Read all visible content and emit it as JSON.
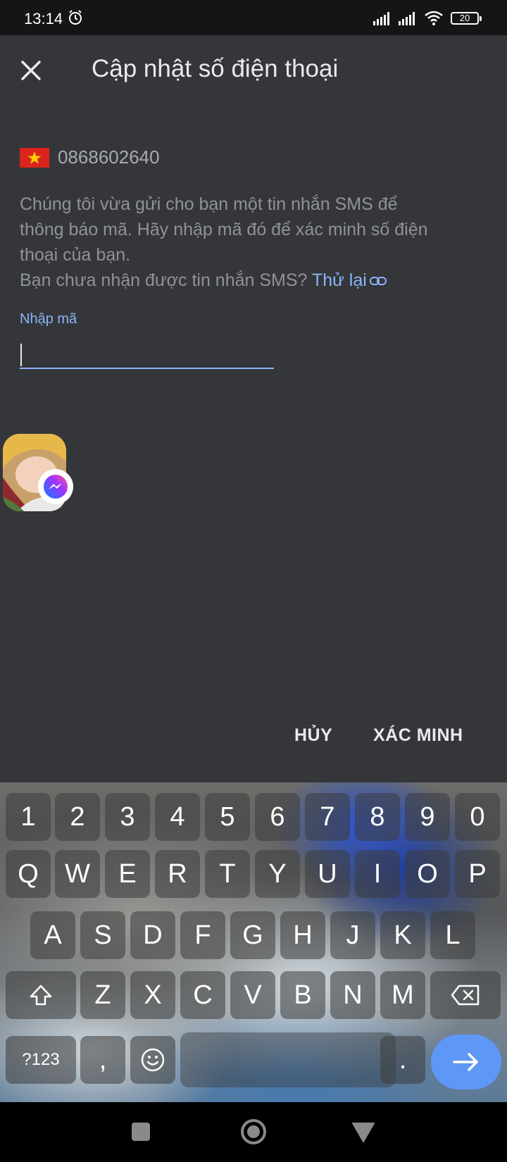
{
  "status_bar": {
    "time": "13:14",
    "battery": "20",
    "icons": [
      "alarm-icon",
      "signal-icon",
      "signal-icon",
      "wifi-icon",
      "battery-icon"
    ]
  },
  "header": {
    "title": "Cập nhật số điện thoại",
    "close_icon": "close-icon"
  },
  "phone": {
    "flag": "vietnam-flag-icon",
    "number": "0868602640"
  },
  "description": {
    "line1": "Chúng tôi vừa gửi cho bạn một tin nhắn SMS để",
    "line2": "thông báo mã. Hãy nhập mã đó để xác minh số điện",
    "line3": "thoại của bạn.",
    "line4_prefix": "Bạn chưa nhận được tin nhắn SMS? ",
    "retry_label": "Thử lại"
  },
  "code_field": {
    "label": "Nhập mã",
    "value": ""
  },
  "chat_head": {
    "badge": "messenger-icon"
  },
  "actions": {
    "cancel_label": "HỦY",
    "verify_label": "XÁC MINH"
  },
  "keyboard": {
    "row1": [
      "1",
      "2",
      "3",
      "4",
      "5",
      "6",
      "7",
      "8",
      "9",
      "0"
    ],
    "row2": [
      "Q",
      "W",
      "E",
      "R",
      "T",
      "Y",
      "U",
      "I",
      "O",
      "P"
    ],
    "row3": [
      "A",
      "S",
      "D",
      "F",
      "G",
      "H",
      "J",
      "K",
      "L"
    ],
    "row4": [
      "Z",
      "X",
      "C",
      "V",
      "B",
      "N",
      "M"
    ],
    "symbols_label": "?123",
    "comma": ",",
    "period": ".",
    "emoji": "emoji-icon",
    "backspace": "backspace-icon",
    "enter": "arrow-right-icon"
  },
  "nav_bar": {
    "items": [
      "recents-icon",
      "home-icon",
      "back-icon"
    ]
  }
}
